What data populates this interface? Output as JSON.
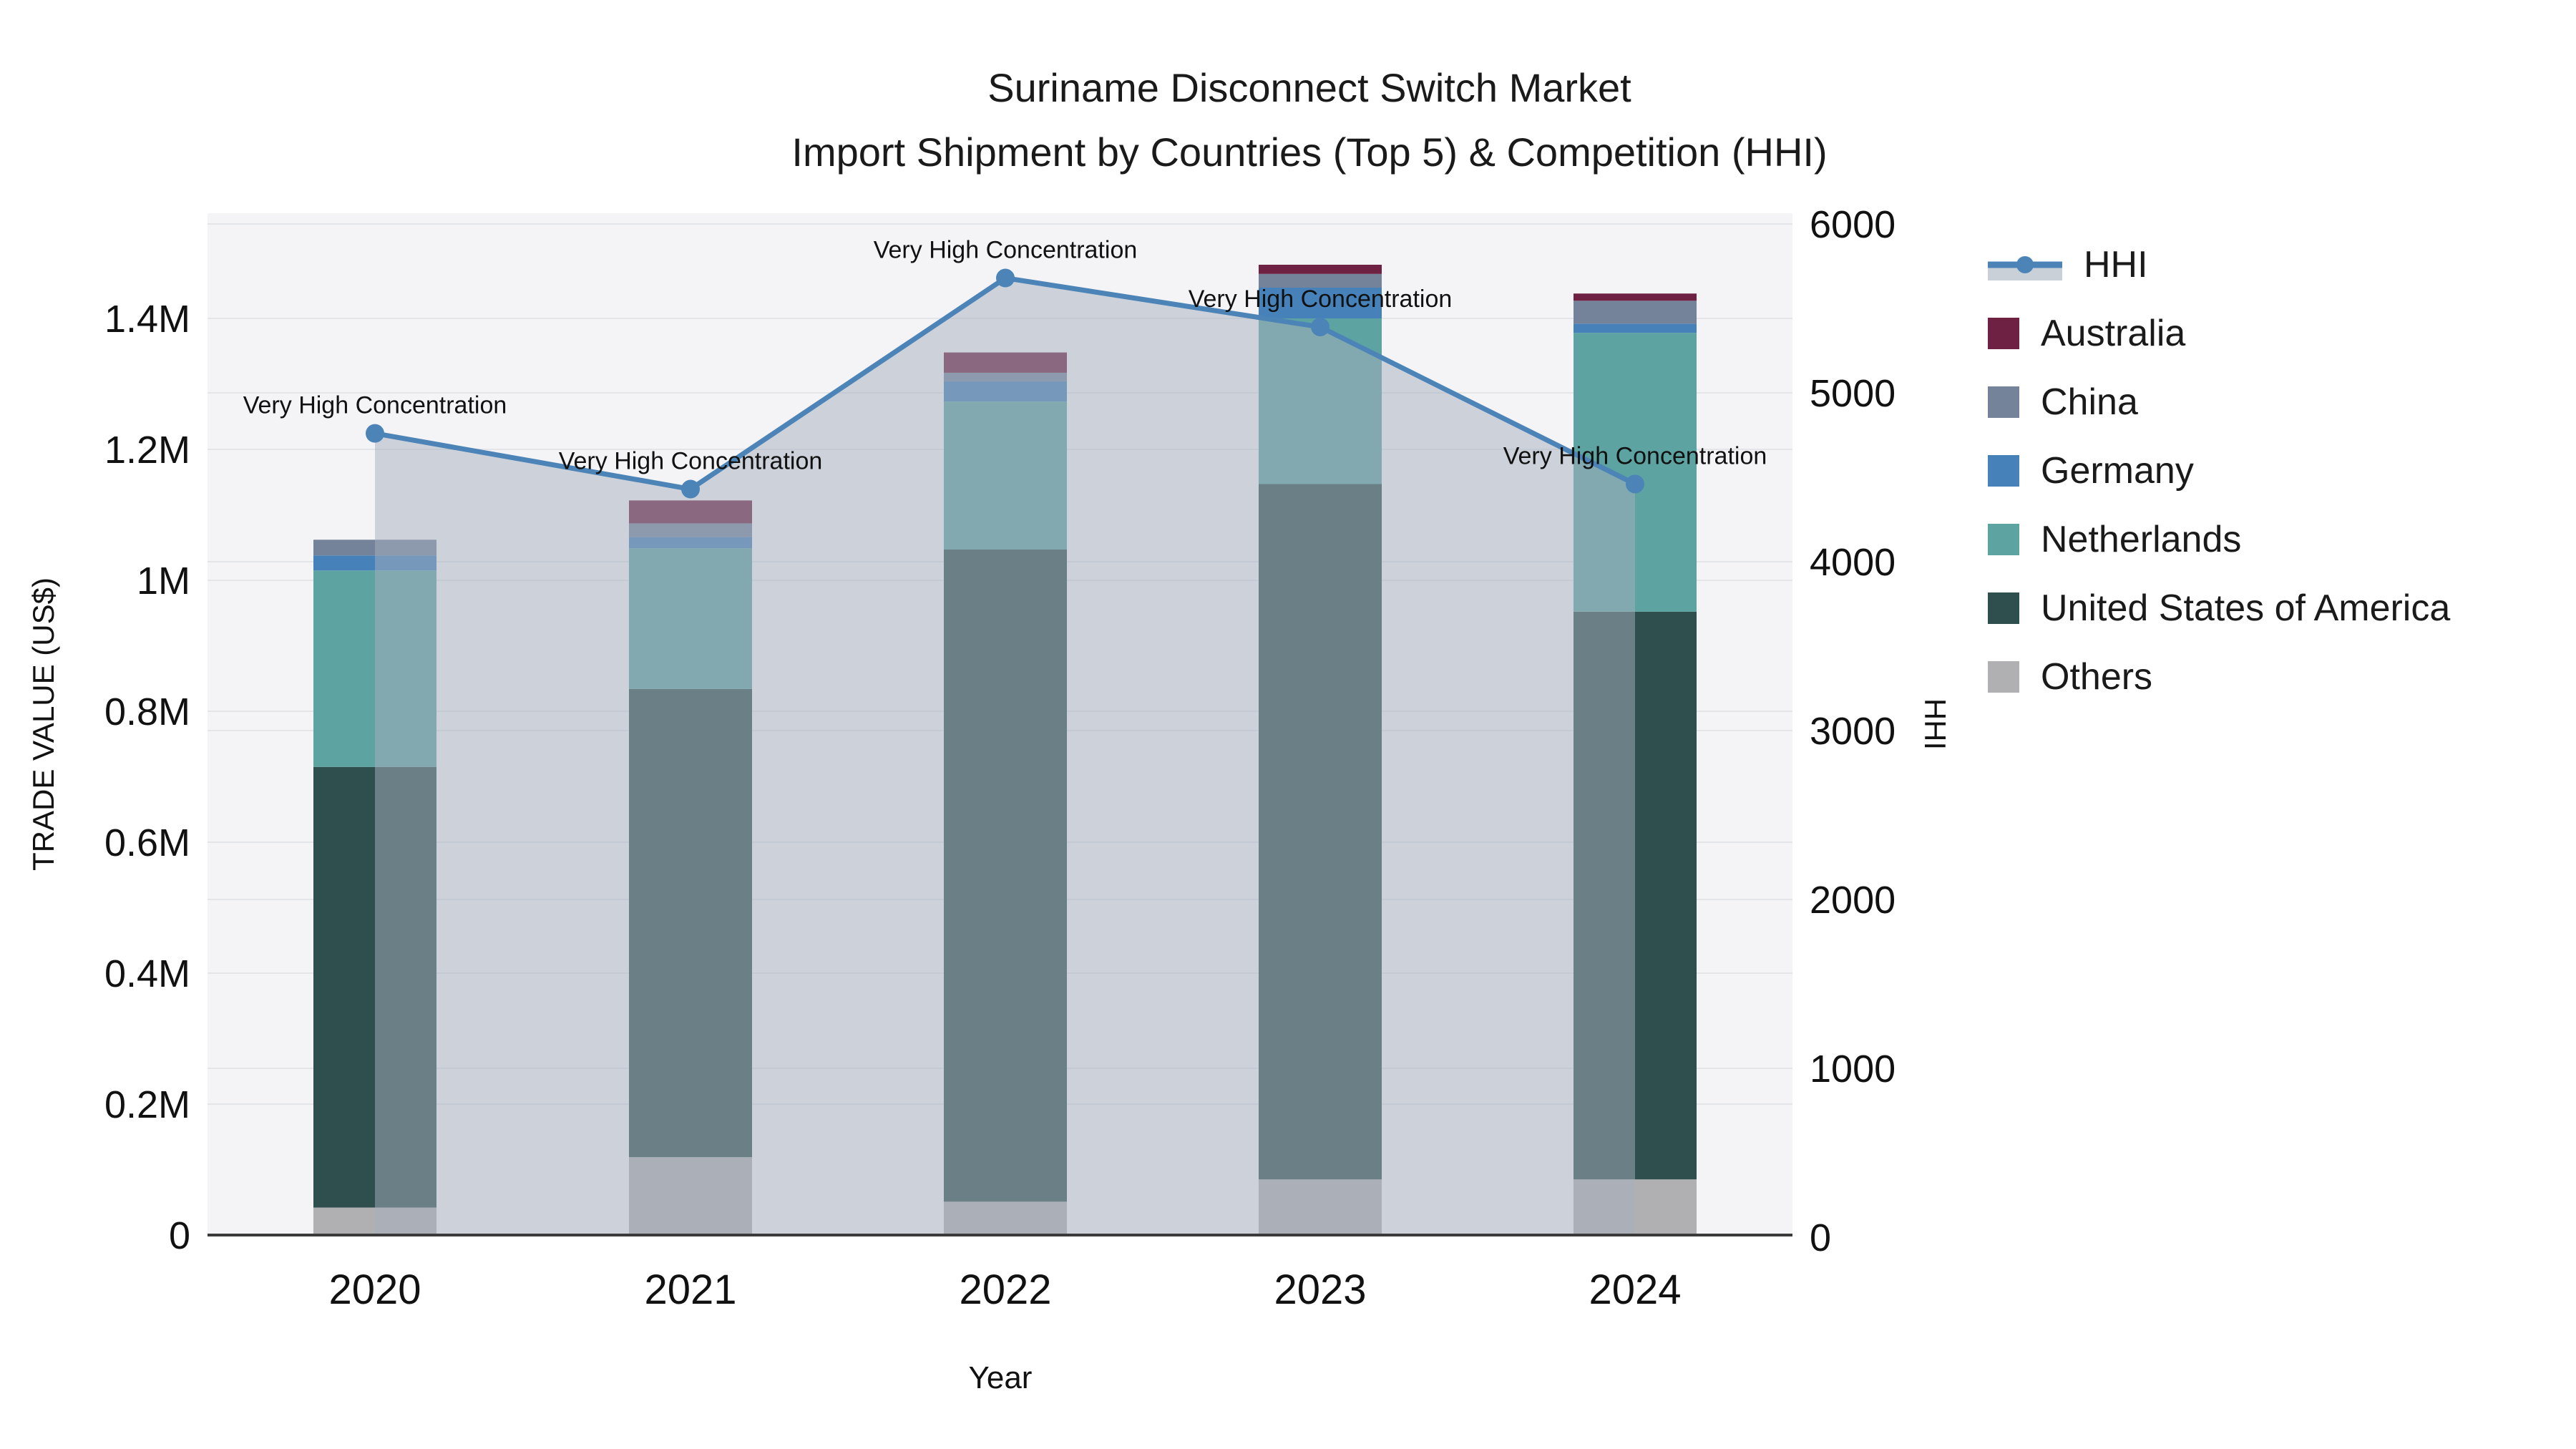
{
  "title": {
    "line1": "Suriname Disconnect Switch Market",
    "line2": "Import Shipment by Countries (Top 5) & Competition (HHI)"
  },
  "chart_data": {
    "type": "stacked-bar-with-line",
    "categories": [
      "2020",
      "2021",
      "2022",
      "2023",
      "2024"
    ],
    "series": [
      {
        "name": "Australia",
        "color": "#6e2142",
        "values": [
          0,
          35000,
          31000,
          14000,
          11000
        ]
      },
      {
        "name": "China",
        "color": "#74839a",
        "values": [
          24000,
          21000,
          13000,
          21000,
          35000
        ]
      },
      {
        "name": "Germany",
        "color": "#4681b9",
        "values": [
          23000,
          17000,
          31000,
          47000,
          14000
        ]
      },
      {
        "name": "Netherlands",
        "color": "#5ca3a1",
        "values": [
          300000,
          215000,
          226000,
          253000,
          426000
        ]
      },
      {
        "name": "United States of America",
        "color": "#2f4f4e",
        "values": [
          673000,
          715000,
          996000,
          1062000,
          867000
        ]
      },
      {
        "name": "Others",
        "color": "#b0b0b3",
        "values": [
          42000,
          119000,
          51000,
          85000,
          85000
        ]
      }
    ],
    "stack_order_bottom_to_top": [
      "Others",
      "United States of America",
      "Netherlands",
      "Germany",
      "China",
      "Australia"
    ],
    "line": {
      "name": "HHI",
      "color": "#4d84b8",
      "fill_color": "rgba(166,176,190,0.5)",
      "values": [
        4760,
        4430,
        5680,
        5390,
        4460
      ],
      "annotations": [
        "Very High Concentration",
        "Very High Concentration",
        "Very High Concentration",
        "Very High Concentration",
        "Very High Concentration"
      ]
    },
    "y_left": {
      "title": "TRADE VALUE (US$)",
      "ticks": [
        "0",
        "0.2M",
        "0.4M",
        "0.6M",
        "0.8M",
        "1M",
        "1.2M",
        "1.4M"
      ],
      "tick_values": [
        0,
        200000,
        400000,
        600000,
        800000,
        1000000,
        1200000,
        1400000
      ],
      "range": [
        0,
        1560000
      ]
    },
    "y_right": {
      "title": "HHI",
      "ticks": [
        "0",
        "1000",
        "2000",
        "3000",
        "4000",
        "5000",
        "6000"
      ],
      "tick_values": [
        0,
        1000,
        2000,
        3000,
        4000,
        5000,
        6000
      ],
      "range": [
        0,
        6060
      ]
    },
    "x_axis": {
      "title": "Year"
    },
    "grid": true,
    "legend_position": "right"
  },
  "legend": {
    "items": [
      {
        "label": "HHI",
        "type": "line",
        "color": "#4d84b8"
      },
      {
        "label": "Australia",
        "type": "square",
        "color": "#6e2142"
      },
      {
        "label": "China",
        "type": "square",
        "color": "#74839a"
      },
      {
        "label": "Germany",
        "type": "square",
        "color": "#4681b9"
      },
      {
        "label": "Netherlands",
        "type": "square",
        "color": "#5ca3a1"
      },
      {
        "label": "United States of America",
        "type": "square",
        "color": "#2f4f4e"
      },
      {
        "label": "Others",
        "type": "square",
        "color": "#b0b0b3"
      }
    ]
  },
  "colors": {
    "plot_bg": "#f4f4f6",
    "grid_line": "#e3e5e8",
    "axis_line": "#3b3b3b",
    "text": "#1a1a1a"
  }
}
